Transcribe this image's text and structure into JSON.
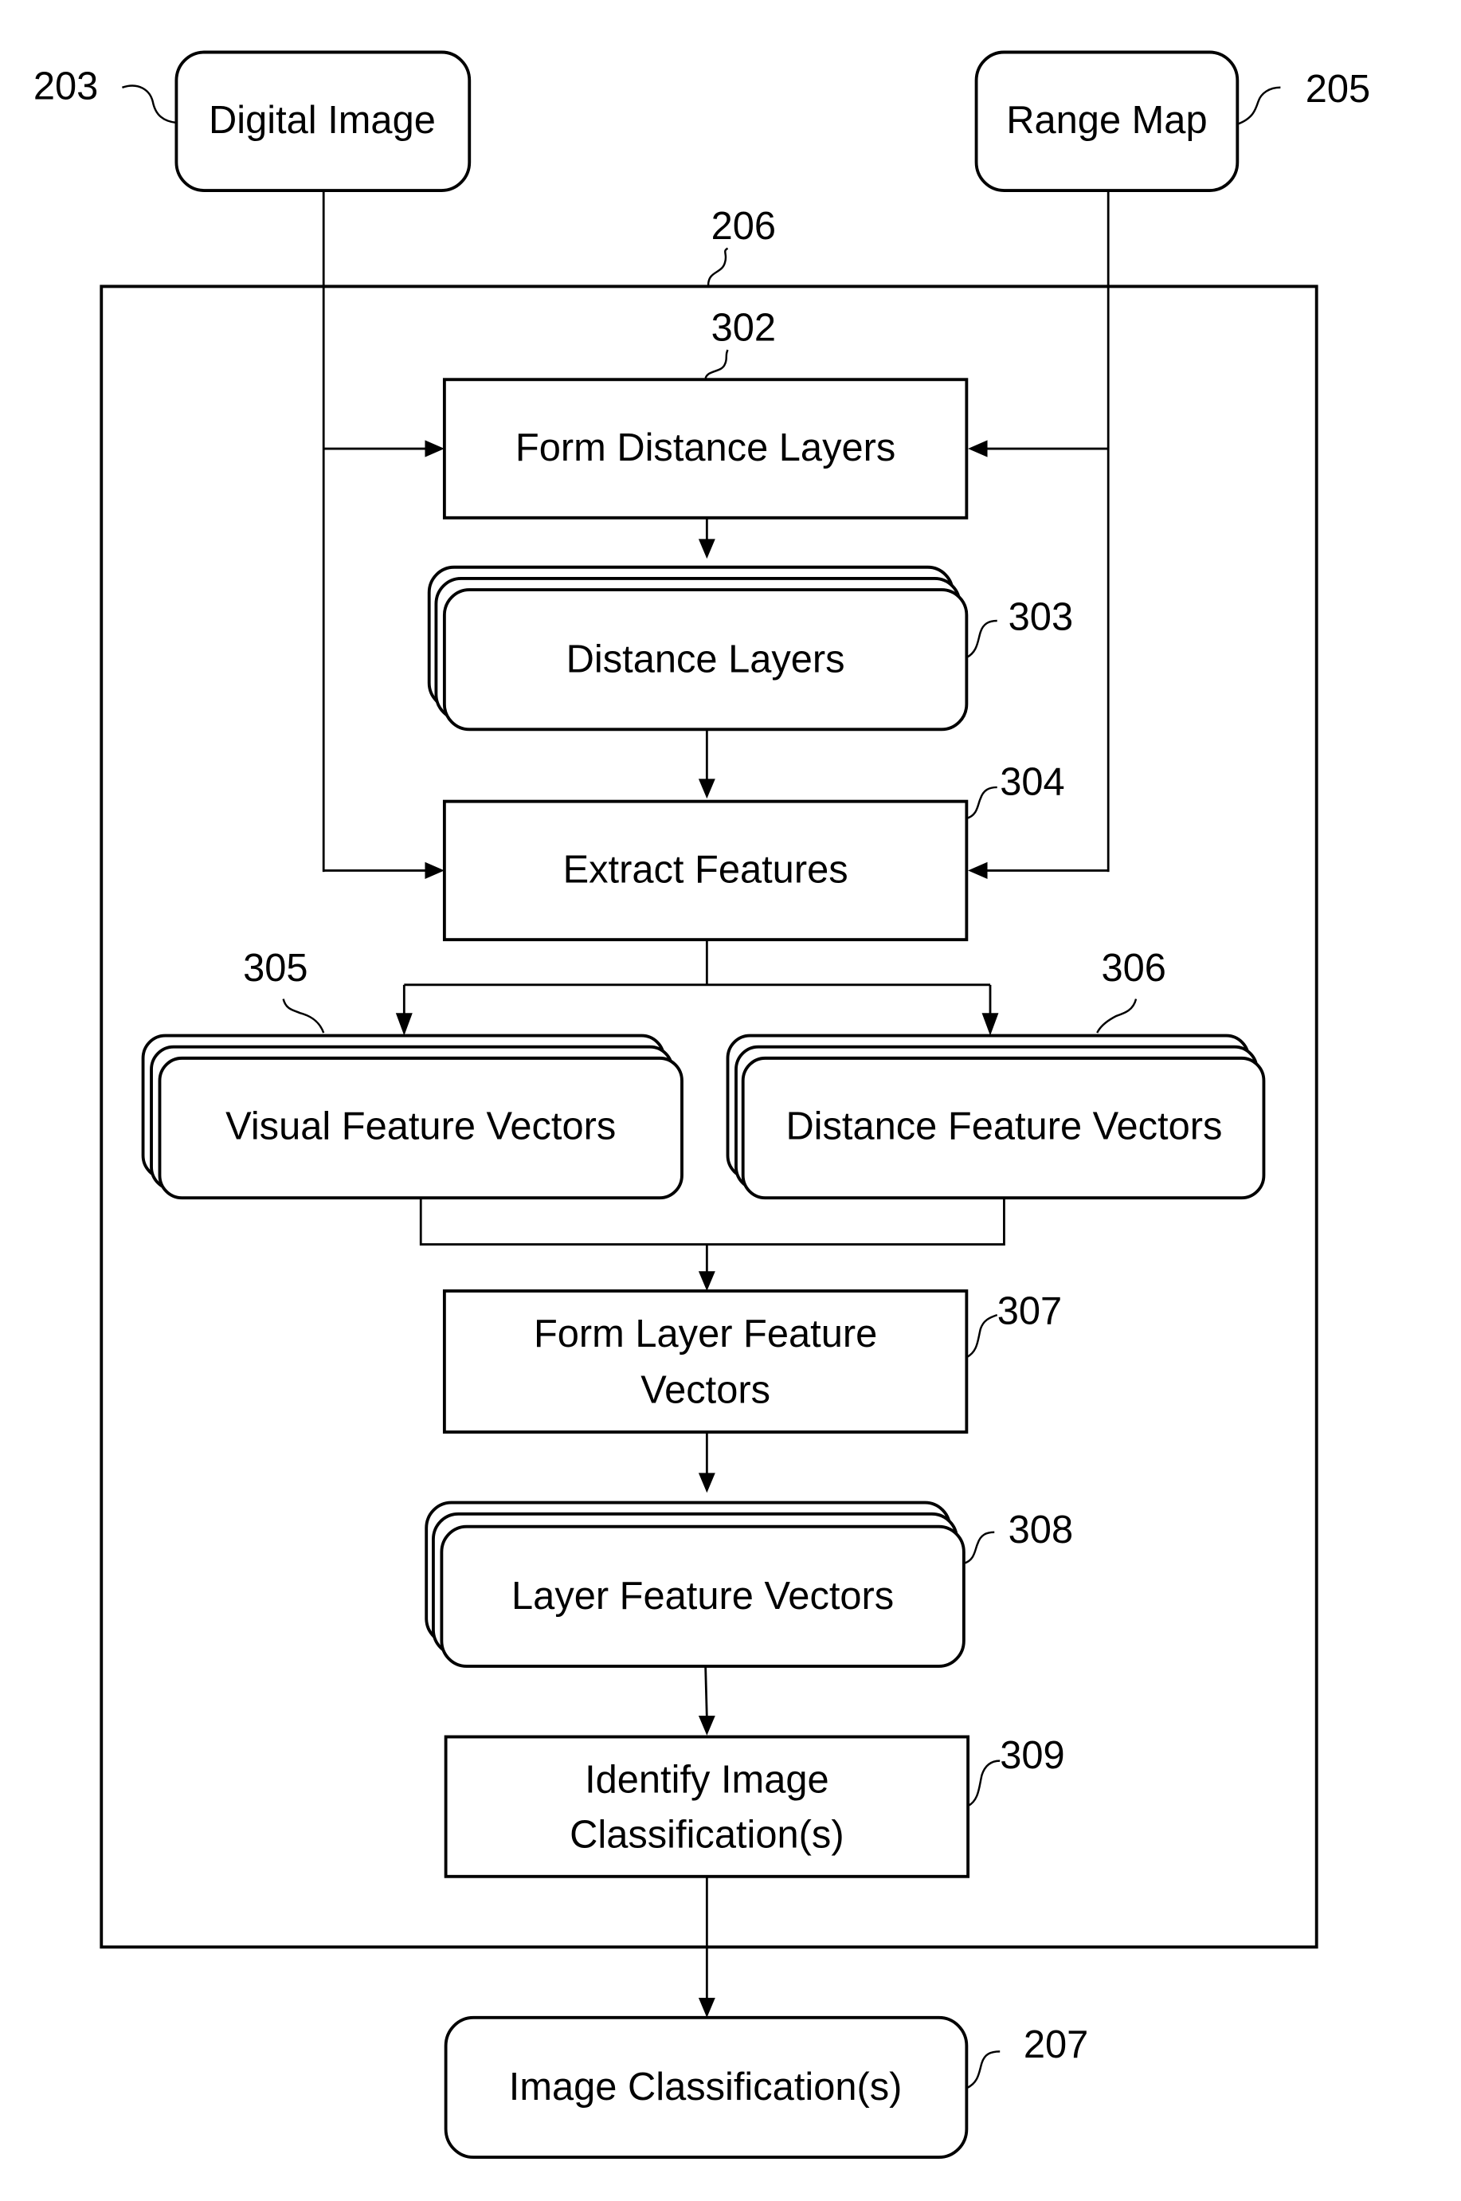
{
  "figure": {
    "inputs": [
      {
        "ref": "203",
        "label": "Digital Image"
      },
      {
        "ref": "205",
        "label": "Range Map"
      }
    ],
    "container": {
      "ref": "206"
    },
    "steps": [
      {
        "ref": "302",
        "label": "Form Distance Layers",
        "kind": "process"
      },
      {
        "ref": "303",
        "label": "Distance Layers",
        "kind": "data-stack"
      },
      {
        "ref": "304",
        "label": "Extract Features",
        "kind": "process"
      },
      {
        "ref": "305",
        "label": "Visual Feature Vectors",
        "kind": "data-stack"
      },
      {
        "ref": "306",
        "label": "Distance Feature Vectors",
        "kind": "data-stack"
      },
      {
        "ref": "307",
        "label_lines": [
          "Form Layer Feature",
          "Vectors"
        ],
        "kind": "process"
      },
      {
        "ref": "308",
        "label": "Layer Feature Vectors",
        "kind": "data-stack"
      },
      {
        "ref": "309",
        "label_lines": [
          "Identify Image",
          "Classification(s)"
        ],
        "kind": "process"
      }
    ],
    "output": {
      "ref": "207",
      "label": "Image Classification(s)"
    }
  }
}
